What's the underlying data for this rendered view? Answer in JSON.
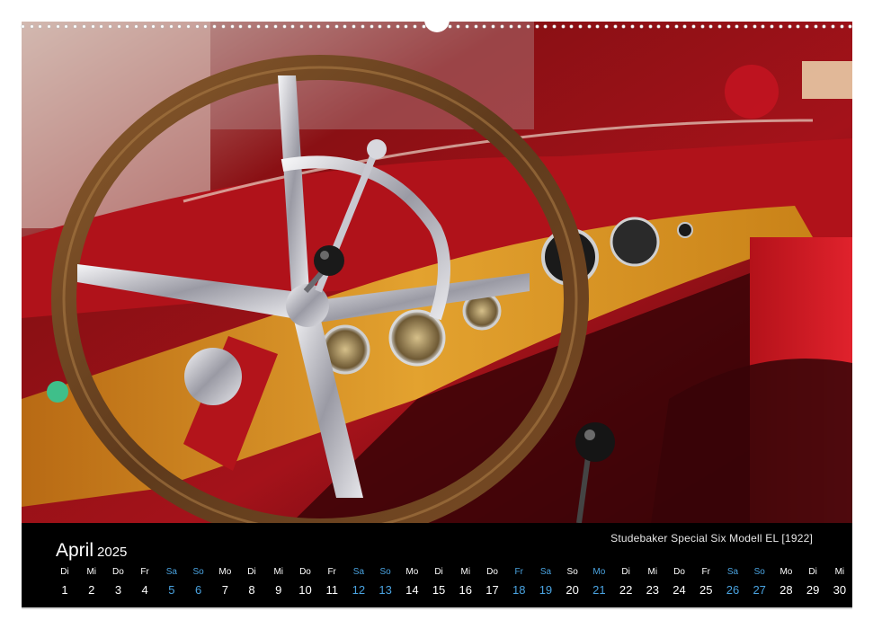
{
  "calendar": {
    "month": "April",
    "year": "2025",
    "caption": "Studebaker Special Six Modell EL [1922]",
    "days": [
      {
        "dn": "Di",
        "dd": "1",
        "blue": false
      },
      {
        "dn": "Mi",
        "dd": "2",
        "blue": false
      },
      {
        "dn": "Do",
        "dd": "3",
        "blue": false
      },
      {
        "dn": "Fr",
        "dd": "4",
        "blue": false
      },
      {
        "dn": "Sa",
        "dd": "5",
        "blue": true
      },
      {
        "dn": "So",
        "dd": "6",
        "blue": true
      },
      {
        "dn": "Mo",
        "dd": "7",
        "blue": false
      },
      {
        "dn": "Di",
        "dd": "8",
        "blue": false
      },
      {
        "dn": "Mi",
        "dd": "9",
        "blue": false
      },
      {
        "dn": "Do",
        "dd": "10",
        "blue": false
      },
      {
        "dn": "Fr",
        "dd": "11",
        "blue": false
      },
      {
        "dn": "Sa",
        "dd": "12",
        "blue": true
      },
      {
        "dn": "So",
        "dd": "13",
        "blue": true
      },
      {
        "dn": "Mo",
        "dd": "14",
        "blue": false
      },
      {
        "dn": "Di",
        "dd": "15",
        "blue": false
      },
      {
        "dn": "Mi",
        "dd": "16",
        "blue": false
      },
      {
        "dn": "Do",
        "dd": "17",
        "blue": false
      },
      {
        "dn": "Fr",
        "dd": "18",
        "blue": true
      },
      {
        "dn": "Sa",
        "dd": "19",
        "blue": true
      },
      {
        "dn": "So",
        "dd": "20",
        "blue": false
      },
      {
        "dn": "Mo",
        "dd": "21",
        "blue": true
      },
      {
        "dn": "Di",
        "dd": "22",
        "blue": false
      },
      {
        "dn": "Mi",
        "dd": "23",
        "blue": false
      },
      {
        "dn": "Do",
        "dd": "24",
        "blue": false
      },
      {
        "dn": "Fr",
        "dd": "25",
        "blue": false
      },
      {
        "dn": "Sa",
        "dd": "26",
        "blue": true
      },
      {
        "dn": "So",
        "dd": "27",
        "blue": true
      },
      {
        "dn": "Mo",
        "dd": "28",
        "blue": false
      },
      {
        "dn": "Di",
        "dd": "29",
        "blue": false
      },
      {
        "dn": "Mi",
        "dd": "30",
        "blue": false
      }
    ]
  },
  "colors": {
    "calendar_background": "#000000",
    "weekend_holiday": "#4aa3e0",
    "day_text": "#ffffff"
  },
  "photo": {
    "icon": "steering-wheel-photo"
  }
}
